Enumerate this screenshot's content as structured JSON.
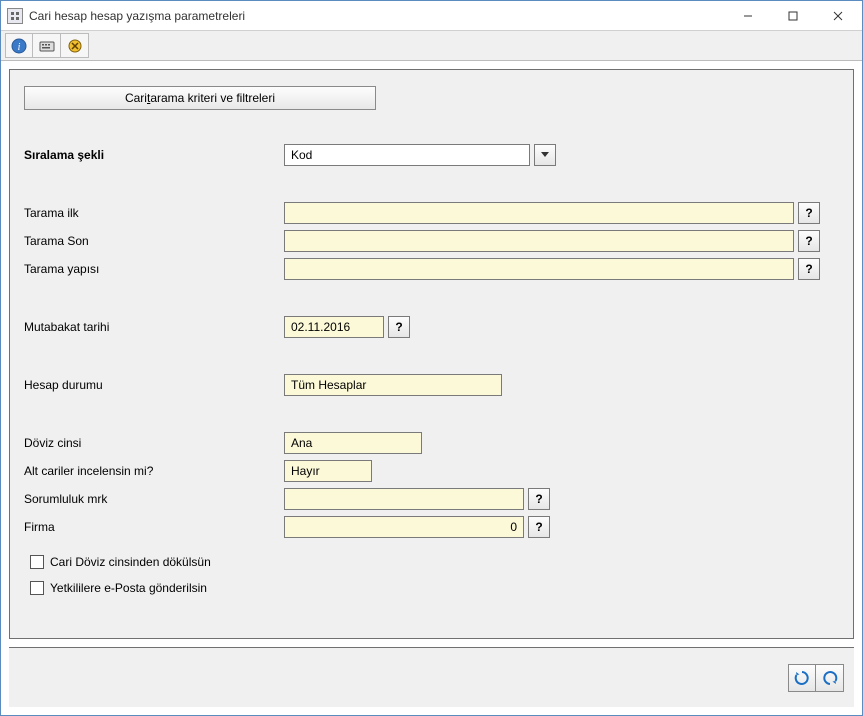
{
  "window": {
    "title": "Cari hesap hesap yazışma parametreleri"
  },
  "toolbar": {
    "btn1": "help",
    "btn2": "keyboard",
    "btn3": "link"
  },
  "buttons": {
    "criteria_prefix": "Cari ",
    "criteria_underline": "t",
    "criteria_suffix": "arama kriteri ve filtreleri"
  },
  "labels": {
    "siralama": "Sıralama şekli",
    "tarama_ilk": "Tarama ilk",
    "tarama_son": "Tarama Son",
    "tarama_yapisi": "Tarama yapısı",
    "mutabakat": "Mutabakat tarihi",
    "hesap_durumu": "Hesap durumu",
    "doviz": "Döviz cinsi",
    "alt_cariler": "Alt cariler incelensin mi?",
    "sorumluluk": "Sorumluluk mrk",
    "firma": "Firma",
    "cb_doviz": "Cari Döviz cinsinden dökülsün",
    "cb_eposta": "Yetkililere e-Posta gönderilsin"
  },
  "values": {
    "siralama": "Kod",
    "tarama_ilk": "",
    "tarama_son": "",
    "tarama_yapisi": "",
    "mutabakat": "02.11.2016",
    "hesap_durumu": "Tüm Hesaplar",
    "doviz": "Ana",
    "alt_cariler": "Hayır",
    "sorumluluk": "",
    "firma": "0"
  },
  "help": "?"
}
